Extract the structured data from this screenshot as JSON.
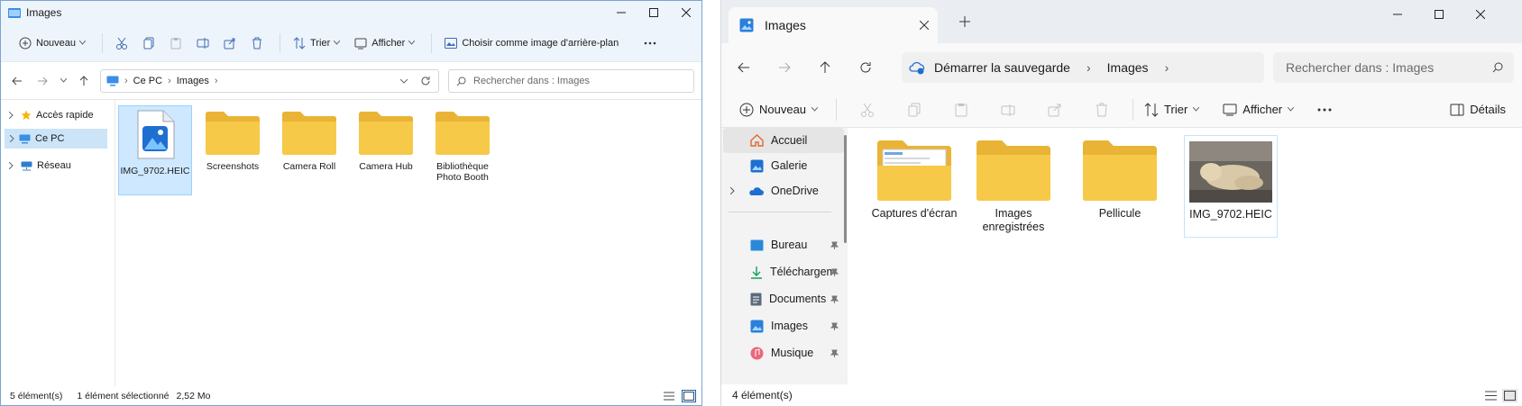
{
  "left_window": {
    "title": "Images",
    "toolbar": {
      "new_label": "Nouveau",
      "sort_label": "Trier",
      "view_label": "Afficher",
      "wallpaper_label": "Choisir comme image d'arrière-plan"
    },
    "address": {
      "segments": [
        "Ce PC",
        "Images"
      ]
    },
    "search": {
      "placeholder": "Rechercher dans : Images"
    },
    "sidebar": {
      "items": [
        {
          "label": "Accès rapide",
          "icon": "star-icon"
        },
        {
          "label": "Ce PC",
          "icon": "pc-icon",
          "selected": true
        },
        {
          "label": "Réseau",
          "icon": "network-icon"
        }
      ]
    },
    "files": [
      {
        "label": "IMG_9702.HEIC",
        "kind": "image-file",
        "selected": true
      },
      {
        "label": "Screenshots",
        "kind": "folder"
      },
      {
        "label": "Camera Roll",
        "kind": "folder"
      },
      {
        "label": "Camera Hub",
        "kind": "folder"
      },
      {
        "label": "Bibliothèque Photo Booth",
        "kind": "folder"
      }
    ],
    "status": {
      "count": "5 élément(s)",
      "selection": "1 élément sélectionné",
      "size": "2,52 Mo"
    }
  },
  "right_window": {
    "tab_title": "Images",
    "address": {
      "segments": [
        "Démarrer la sauvegarde",
        "Images"
      ]
    },
    "search": {
      "placeholder": "Rechercher dans : Images"
    },
    "toolbar": {
      "new_label": "Nouveau",
      "sort_label": "Trier",
      "view_label": "Afficher",
      "details_label": "Détails"
    },
    "sidebar": {
      "items": [
        {
          "label": "Accueil",
          "icon": "home-icon",
          "selected": true
        },
        {
          "label": "Galerie",
          "icon": "gallery-icon"
        },
        {
          "label": "OneDrive",
          "icon": "onedrive-icon"
        },
        {
          "label": "Bureau",
          "icon": "desktop-icon",
          "pinned": true
        },
        {
          "label": "Téléchargem",
          "icon": "download-icon",
          "pinned": true
        },
        {
          "label": "Documents",
          "icon": "documents-icon",
          "pinned": true
        },
        {
          "label": "Images",
          "icon": "images-icon",
          "pinned": true
        },
        {
          "label": "Musique",
          "icon": "music-icon",
          "pinned": true
        }
      ]
    },
    "files": [
      {
        "label": "Captures d'écran",
        "kind": "folder-preview"
      },
      {
        "label": "Images enregistrées",
        "kind": "folder"
      },
      {
        "label": "Pellicule",
        "kind": "folder"
      },
      {
        "label": "IMG_9702.HEIC",
        "kind": "photo-thumbnail",
        "selected": true
      }
    ],
    "status": {
      "count": "4 élément(s)"
    }
  },
  "colors": {
    "folder_yellow": "#f7c948",
    "folder_back": "#e9b435",
    "accent": "#0067c0",
    "selection": "#cde8ff"
  }
}
